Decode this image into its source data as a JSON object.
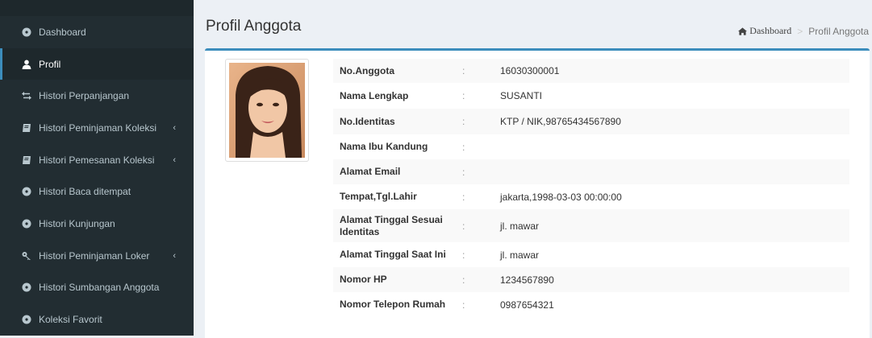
{
  "sidebar": {
    "items": [
      {
        "label": "Dashboard",
        "icon": "dashboard-icon",
        "active": false,
        "chevron": ""
      },
      {
        "label": "Profil",
        "icon": "user-icon",
        "active": true,
        "chevron": ""
      },
      {
        "label": "Histori Perpanjangan",
        "icon": "exchange-icon",
        "active": false,
        "chevron": ""
      },
      {
        "label": "Histori Peminjaman Koleksi",
        "icon": "book-icon",
        "active": false,
        "chevron": "‹"
      },
      {
        "label": "Histori Pemesanan Koleksi",
        "icon": "book-icon",
        "active": false,
        "chevron": "‹"
      },
      {
        "label": "Histori Baca ditempat",
        "icon": "dashboard-icon",
        "active": false,
        "chevron": ""
      },
      {
        "label": "Histori Kunjungan",
        "icon": "dashboard-icon",
        "active": false,
        "chevron": ""
      },
      {
        "label": "Histori Peminjaman Loker",
        "icon": "key-icon",
        "active": false,
        "chevron": "‹"
      },
      {
        "label": "Histori Sumbangan Anggota",
        "icon": "dashboard-icon",
        "active": false,
        "chevron": ""
      },
      {
        "label": "Koleksi Favorit",
        "icon": "dashboard-icon",
        "active": false,
        "chevron": ""
      }
    ]
  },
  "header": {
    "title": "Profil Anggota",
    "breadcrumb_home": "Dashboard",
    "breadcrumb_sep": ">",
    "breadcrumb_current": "Profil Anggota"
  },
  "profile": {
    "colon": ":",
    "rows": [
      {
        "label": "No.Anggota",
        "value": "16030300001"
      },
      {
        "label": "Nama Lengkap",
        "value": "SUSANTI"
      },
      {
        "label": "No.Identitas",
        "value": "KTP / NIK,98765434567890"
      },
      {
        "label": "Nama Ibu Kandung",
        "value": ""
      },
      {
        "label": "Alamat Email",
        "value": ""
      },
      {
        "label": "Tempat,Tgl.Lahir",
        "value": "jakarta,1998-03-03 00:00:00"
      },
      {
        "label": "Alamat Tinggal Sesuai Identitas",
        "value": "jl. mawar"
      },
      {
        "label": "Alamat Tinggal Saat Ini",
        "value": "jl. mawar"
      },
      {
        "label": "Nomor HP",
        "value": "1234567890"
      },
      {
        "label": "Nomor Telepon Rumah",
        "value": "0987654321"
      }
    ]
  }
}
